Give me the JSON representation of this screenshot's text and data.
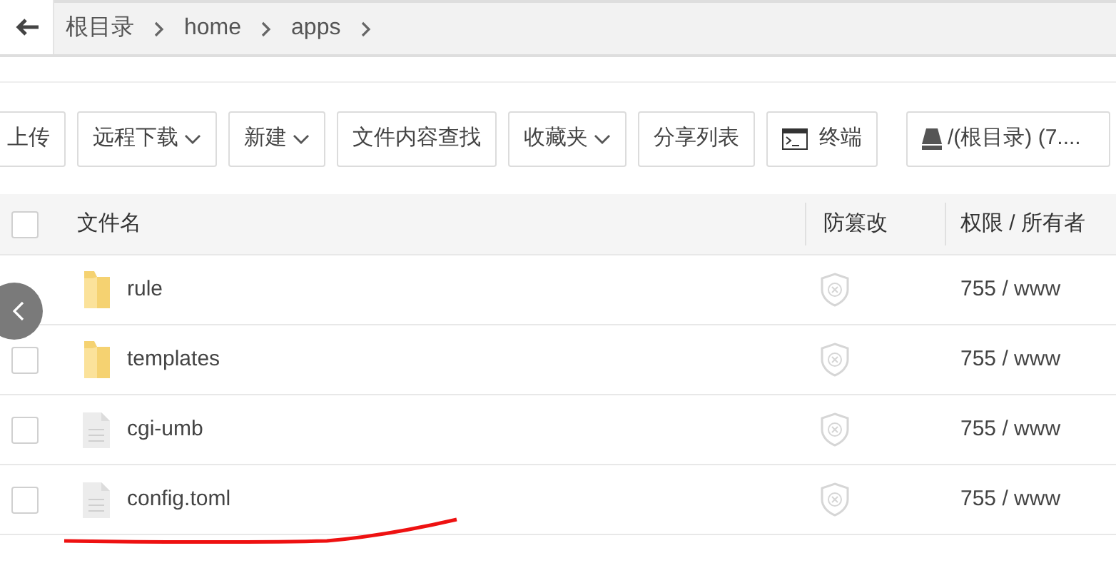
{
  "breadcrumb": [
    "根目录",
    "home",
    "apps"
  ],
  "toolbar": [
    {
      "label": "上传",
      "kind": "plain"
    },
    {
      "label": "远程下载",
      "kind": "dropdown"
    },
    {
      "label": "新建",
      "kind": "dropdown"
    },
    {
      "label": "文件内容查找",
      "kind": "plain"
    },
    {
      "label": "收藏夹",
      "kind": "dropdown"
    },
    {
      "label": "分享列表",
      "kind": "plain"
    },
    {
      "label": "终端",
      "kind": "terminal"
    },
    {
      "label": "/(根目录) (7....",
      "kind": "disk"
    }
  ],
  "table": {
    "columns": [
      "文件名",
      "防篡改",
      "权限 / 所有者"
    ],
    "header_checked": false,
    "rows": [
      {
        "name": "rule",
        "kind": "folder",
        "protected": false,
        "permission": "755 / www"
      },
      {
        "name": "templates",
        "kind": "folder",
        "checked": false,
        "protected": false,
        "permission": "755 / www"
      },
      {
        "name": "cgi-umb",
        "kind": "file",
        "checked": false,
        "protected": false,
        "permission": "755 / www"
      },
      {
        "name": "config.toml",
        "kind": "file",
        "checked": false,
        "protected": false,
        "permission": "755 / www"
      }
    ]
  }
}
